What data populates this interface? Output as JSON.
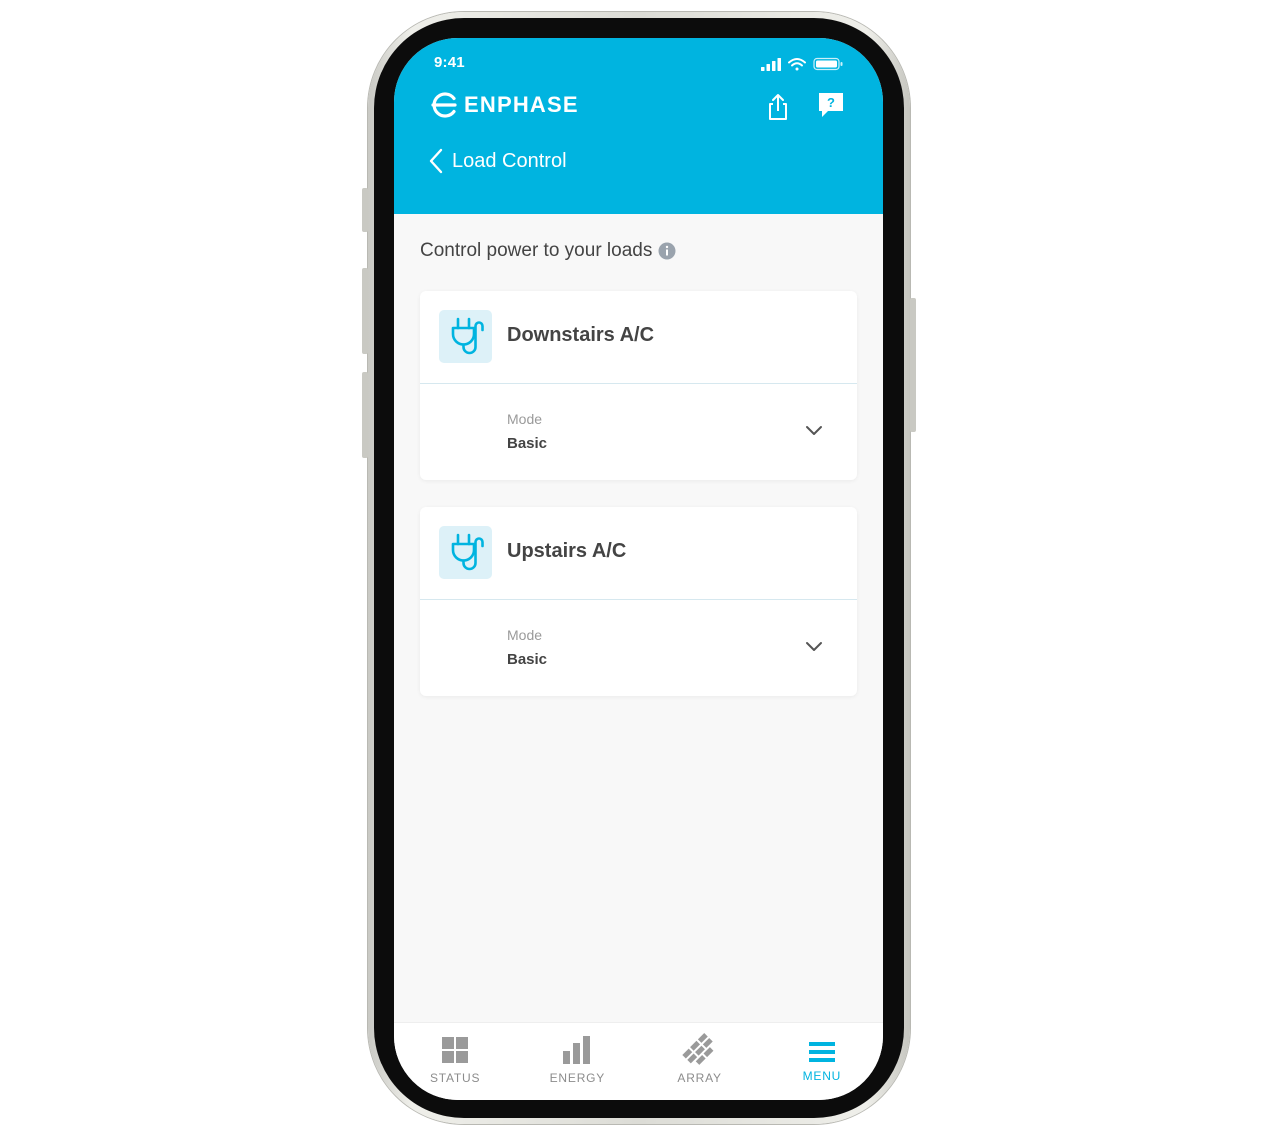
{
  "status_bar": {
    "time": "9:41"
  },
  "header": {
    "brand": "ENPHASE",
    "back_label": "Load Control",
    "share_icon": "share-icon",
    "help_icon": "help-icon"
  },
  "main": {
    "section_title": "Control power to your loads",
    "loads": [
      {
        "name": "Downstairs A/C",
        "mode_label": "Mode",
        "mode_value": "Basic"
      },
      {
        "name": "Upstairs A/C",
        "mode_label": "Mode",
        "mode_value": "Basic"
      }
    ]
  },
  "tabbar": {
    "tabs": [
      {
        "label": "STATUS",
        "icon": "grid-icon"
      },
      {
        "label": "ENERGY",
        "icon": "bar-chart-icon"
      },
      {
        "label": "ARRAY",
        "icon": "solar-array-icon"
      },
      {
        "label": "MENU",
        "icon": "hamburger-icon",
        "active": true
      }
    ]
  },
  "colors": {
    "accent": "#00b4e0",
    "text": "#444444",
    "muted": "#9a9a9a",
    "background": "#f8f8f8"
  }
}
